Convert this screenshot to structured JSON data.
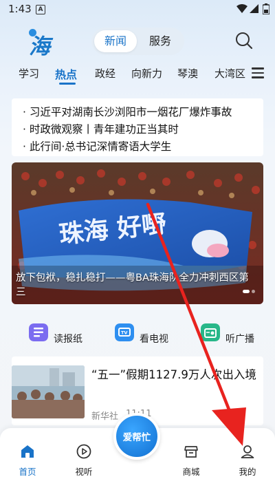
{
  "status": {
    "time": "1:43",
    "badge": "A"
  },
  "header": {
    "logo_char": "海",
    "segments": [
      "新闻",
      "服务"
    ]
  },
  "tabs": [
    "学习",
    "热点",
    "政经",
    "向新力",
    "琴澳",
    "大湾区"
  ],
  "headlines": [
    "· 习近平对湖南长沙浏阳市一烟花厂爆炸事故",
    "· 时政微观察丨青年建功正当其时",
    "· 此行间·总书记深情寄语大学生"
  ],
  "hero": {
    "banner_text": "珠海 好嘢",
    "caption": "放下包袱，稳扎稳打——粤BA珠海队全力冲刺西区第三"
  },
  "quick_links": [
    {
      "label": "读报纸",
      "icon": "newspaper-icon"
    },
    {
      "label": "看电视",
      "icon": "tv-icon"
    },
    {
      "label": "听广播",
      "icon": "radio-icon"
    }
  ],
  "news": {
    "title": "“五一”假期1127.9万人次出入境",
    "source": "新华社",
    "time": "11:11"
  },
  "bottom_nav": {
    "items": [
      {
        "label": "首页",
        "icon": "home-icon"
      },
      {
        "label": "视听",
        "icon": "play-icon"
      },
      {
        "label": "商城",
        "icon": "store-icon"
      },
      {
        "label": "我的",
        "icon": "profile-icon"
      }
    ],
    "center_label": "爱帮忙"
  },
  "colors": {
    "accent": "#1973c8",
    "arrow": "#e8231f"
  }
}
